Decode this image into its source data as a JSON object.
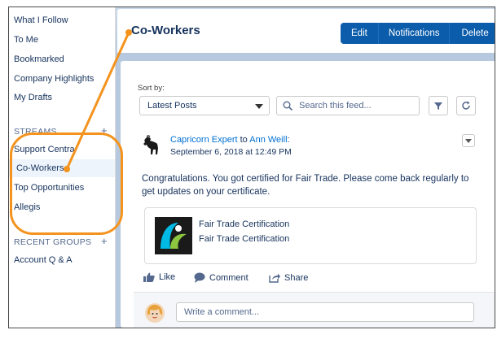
{
  "sidebar": {
    "items": [
      {
        "label": "What I Follow"
      },
      {
        "label": "To Me"
      },
      {
        "label": "Bookmarked"
      },
      {
        "label": "Company Highlights"
      },
      {
        "label": "My Drafts"
      }
    ],
    "streams": {
      "heading": "STREAMS",
      "items": [
        {
          "label": "Support Centra"
        },
        {
          "label": "Co-Workers",
          "selected": true
        },
        {
          "label": "Top Opportunities"
        },
        {
          "label": "Allegis"
        }
      ]
    },
    "recent_groups": {
      "heading": "RECENT GROUPS",
      "items": [
        {
          "label": "Account Q & A"
        }
      ]
    }
  },
  "header": {
    "title": "Co-Workers",
    "buttons": {
      "edit": "Edit",
      "notifications": "Notifications",
      "delete": "Delete"
    }
  },
  "feed": {
    "sort_label": "Sort by:",
    "sort_value": "Latest Posts",
    "search_placeholder": "Search this feed...",
    "post": {
      "author": "Capricorn Expert",
      "to_word": "to",
      "recipient": "Ann Weill",
      "colon": ":",
      "date": "September 6, 2018 at 12:49 PM",
      "body": "Congratulations. You got certified for Fair Trade. Please come back regularly to get updates on your certificate.",
      "attachment": {
        "title": "Fair Trade Certification",
        "subtitle": "Fair Trade Certification"
      },
      "actions": {
        "like": "Like",
        "comment": "Comment",
        "share": "Share"
      }
    },
    "comment_placeholder": "Write a comment..."
  },
  "colors": {
    "brand_button": "#0b5cab",
    "link": "#0070d2",
    "annotation": "#f4931e",
    "fairtrade_blue": "#00b9e4",
    "fairtrade_green": "#8dc63f"
  }
}
